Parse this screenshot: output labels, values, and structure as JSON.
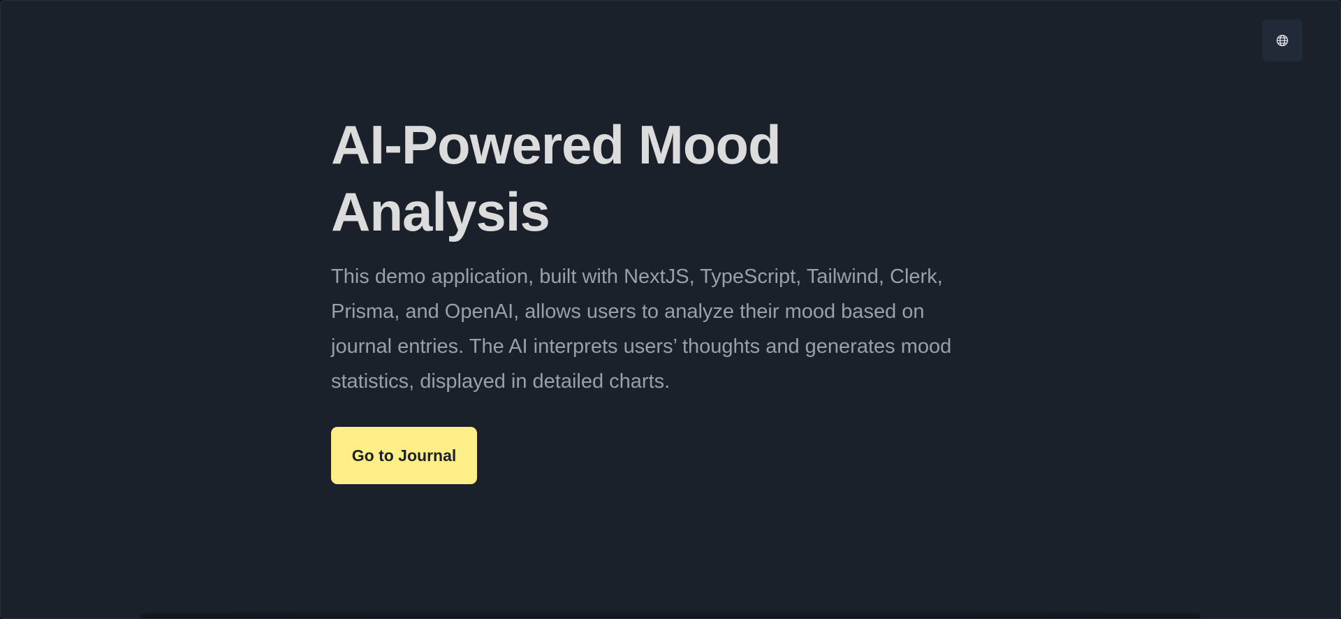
{
  "header": {
    "language_icon": "globe-icon"
  },
  "hero": {
    "title_line1": "AI-Powered Mood",
    "title_line2": "Analysis",
    "description": "This demo application, built with NextJS, TypeScript, Tailwind, Clerk, Prisma, and OpenAI, allows users to analyze their mood based on journal entries. The AI interprets users’ thoughts and generates mood statistics, displayed in detailed charts.",
    "cta_label": "Go to Journal"
  },
  "colors": {
    "background": "#1b212a",
    "title": "#dcdcdc",
    "description": "#9aa0a9",
    "cta_background": "#fdee87",
    "icon_button_background": "#212a39"
  }
}
